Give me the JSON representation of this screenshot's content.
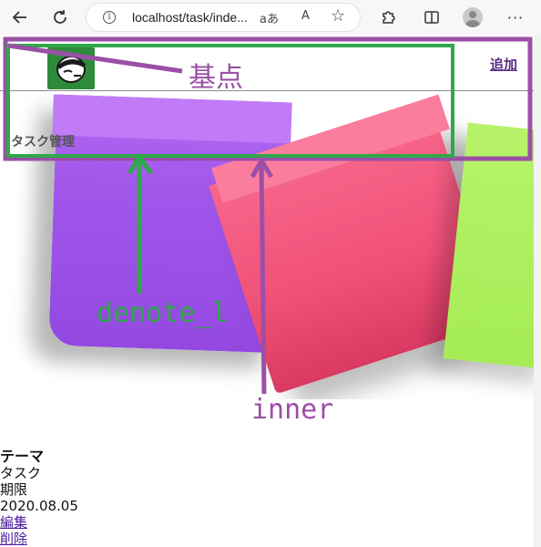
{
  "browser": {
    "url": "localhost/task/inde...",
    "read_aloud_label": "A",
    "translate_label": "aあ",
    "icons": [
      "back-icon",
      "refresh-icon",
      "info-icon",
      "translate-icon",
      "read-aloud-icon",
      "favorite-star-icon",
      "extensions-icon",
      "split-screen-icon",
      "profile-avatar",
      "more-icon"
    ]
  },
  "nav": {
    "add_link": "追加",
    "site_name": "タスク管理"
  },
  "annotations": {
    "base_label": "基点",
    "denote_label": "denote_l",
    "inner_label": "inner",
    "colors": {
      "purple": "#9b4fa6",
      "green": "#2ea84a"
    }
  },
  "task": {
    "theme_label": "テーマ",
    "title": "タスク",
    "deadline_label": "期限",
    "deadline": "2020.08.05",
    "edit_link": "編集",
    "delete_link": "削除"
  },
  "colors": {
    "note_purple": "#a257eb",
    "note_pink": "#f05078",
    "note_green": "#a5ec56",
    "logo_green": "#2e8b3c",
    "link": "#5a2a86"
  }
}
